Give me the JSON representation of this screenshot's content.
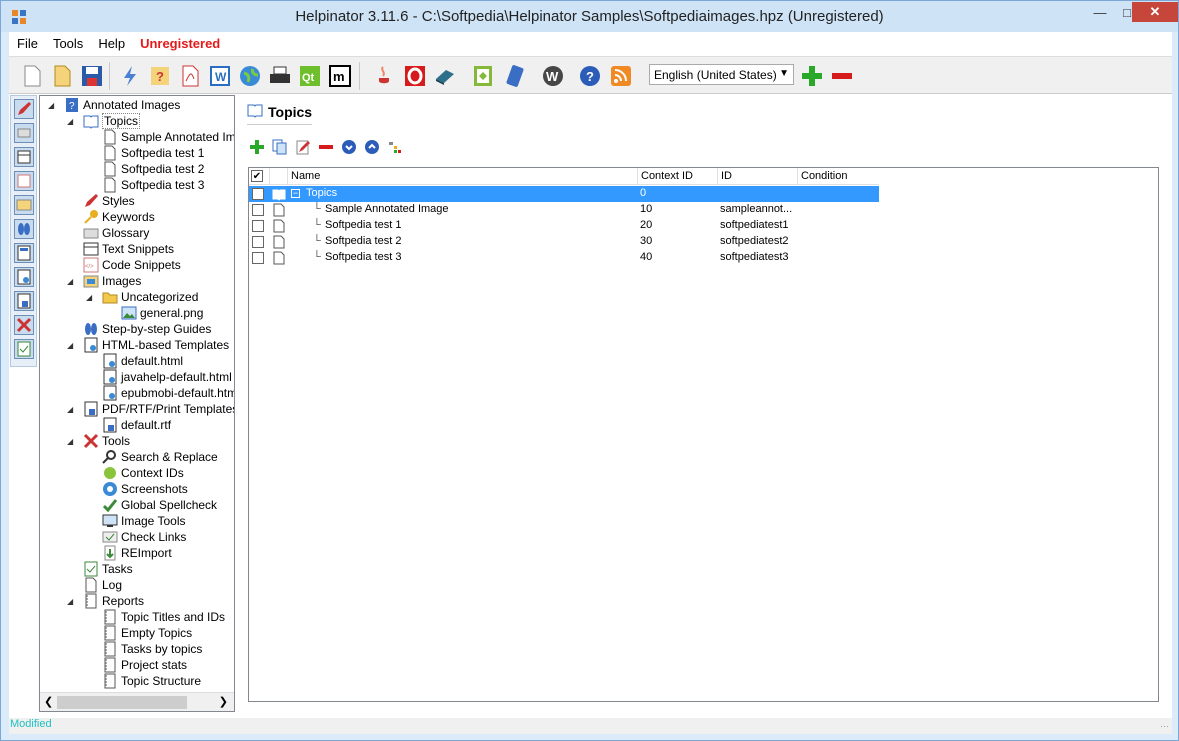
{
  "window": {
    "title": "Helpinator 3.11.6 - C:\\Softpedia\\Helpinator Samples\\Softpediaimages.hpz (Unregistered)"
  },
  "menu": {
    "items": [
      "File",
      "Tools",
      "Help"
    ],
    "unregistered": "Unregistered"
  },
  "language": {
    "selected": "English (United States)"
  },
  "toolbar": {
    "icons": [
      "new-file-icon",
      "open-file-icon",
      "save-icon",
      "lightning-icon",
      "wizard-icon",
      "pdf-icon",
      "word-icon",
      "web-icon",
      "print-icon",
      "qt-icon",
      "markdown-icon",
      "java-icon",
      "opera-icon",
      "ebook-icon",
      "epub-icon",
      "mobile-icon",
      "wordpress-icon",
      "help-icon",
      "rss-icon"
    ]
  },
  "tree": {
    "root": "Annotated Images",
    "topics": "Topics",
    "topic_items": [
      "Sample Annotated Image",
      "Softpedia test 1",
      "Softpedia test 2",
      "Softpedia test 3"
    ],
    "styles": "Styles",
    "keywords": "Keywords",
    "glossary": "Glossary",
    "text_snippets": "Text Snippets",
    "code_snippets": "Code Snippets",
    "images": "Images",
    "uncategorized": "Uncategorized",
    "general_png": "general.png",
    "guides": "Step-by-step Guides",
    "html_templates": "HTML-based Templates",
    "html_items": [
      "default.html",
      "javahelp-default.html",
      "epubmobi-default.html"
    ],
    "pdf_templates": "PDF/RTF/Print Templates",
    "rtf": "default.rtf",
    "tools": "Tools",
    "tool_items": [
      "Search & Replace",
      "Context IDs",
      "Screenshots",
      "Global Spellcheck",
      "Image Tools",
      "Check Links",
      "REImport"
    ],
    "tasks": "Tasks",
    "log": "Log",
    "reports": "Reports",
    "report_items": [
      "Topic Titles and IDs",
      "Empty Topics",
      "Tasks by topics",
      "Project stats",
      "Topic Structure"
    ]
  },
  "panel": {
    "title": "Topics"
  },
  "grid": {
    "headers": {
      "name": "Name",
      "context_id": "Context ID",
      "id": "ID",
      "condition": "Condition"
    },
    "rows": [
      {
        "name": "Topics",
        "context_id": "0",
        "id": "",
        "condition": ""
      },
      {
        "name": "Sample Annotated Image",
        "context_id": "10",
        "id": "sampleannot...",
        "condition": ""
      },
      {
        "name": "Softpedia test 1",
        "context_id": "20",
        "id": "softpediatest1",
        "condition": ""
      },
      {
        "name": "Softpedia test 2",
        "context_id": "30",
        "id": "softpediatest2",
        "condition": ""
      },
      {
        "name": "Softpedia test 3",
        "context_id": "40",
        "id": "softpediatest3",
        "condition": ""
      }
    ]
  },
  "status": {
    "text": "Modified"
  }
}
